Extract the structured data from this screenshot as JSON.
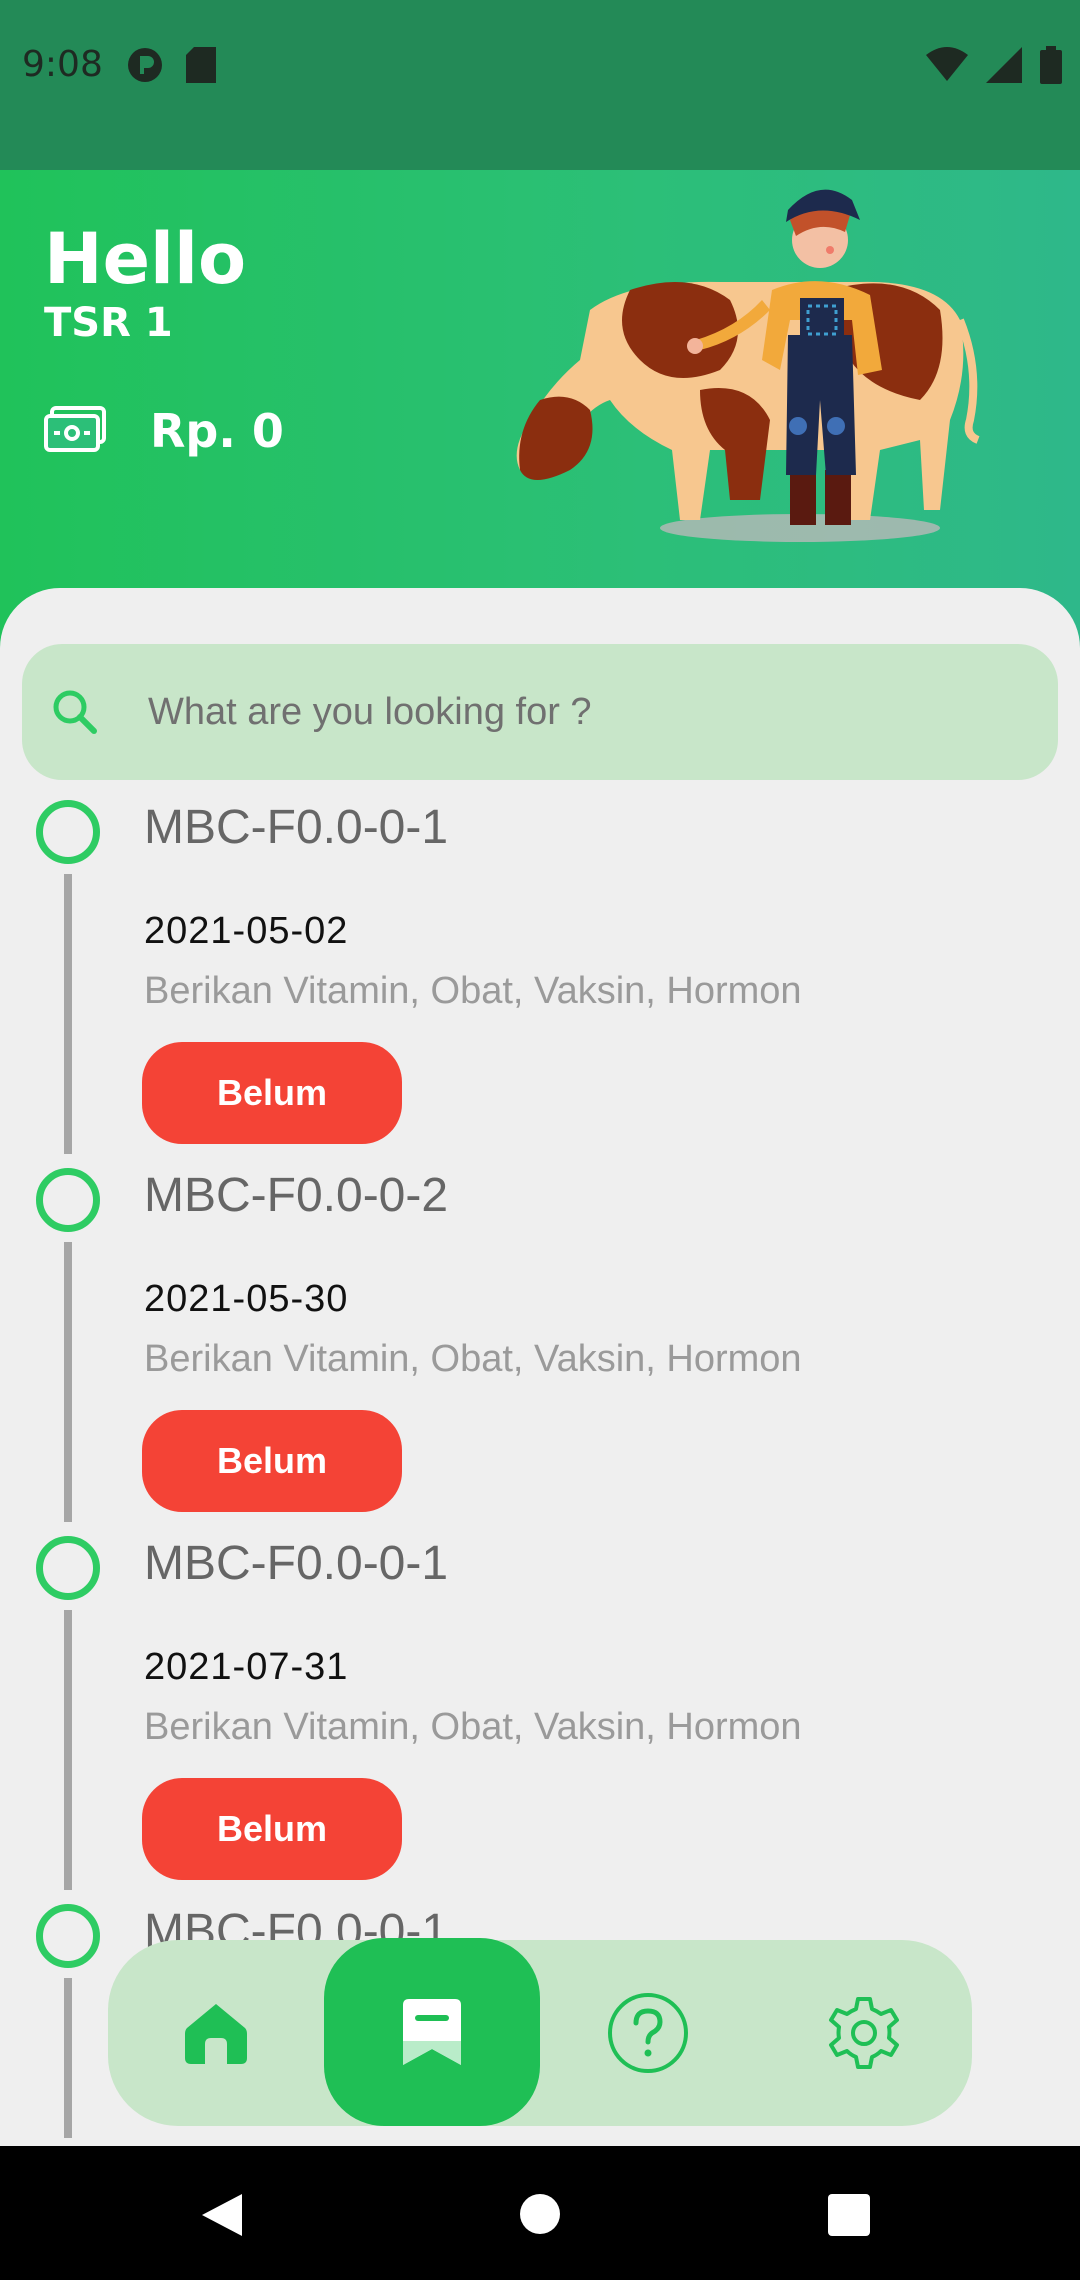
{
  "status_bar": {
    "time": "9:08"
  },
  "header": {
    "greeting": "Hello",
    "username": "TSR 1",
    "balance": "Rp. 0"
  },
  "search": {
    "placeholder": "What are you looking for ?"
  },
  "timeline": [
    {
      "title": "MBC-F0.0-0-1",
      "date": "2021-05-02",
      "description": "Berikan Vitamin, Obat, Vaksin, Hormon",
      "status": "Belum"
    },
    {
      "title": "MBC-F0.0-0-2",
      "date": "2021-05-30",
      "description": "Berikan Vitamin, Obat, Vaksin, Hormon",
      "status": "Belum"
    },
    {
      "title": "MBC-F0.0-0-1",
      "date": "2021-07-31",
      "description": "Berikan Vitamin, Obat, Vaksin, Hormon",
      "status": "Belum"
    },
    {
      "title": "MBC-F0.0-0-1"
    }
  ],
  "bottom_nav": {
    "items": [
      {
        "icon": "home-icon"
      },
      {
        "icon": "schedule-icon",
        "active": true
      },
      {
        "icon": "help-icon"
      },
      {
        "icon": "settings-icon"
      }
    ]
  },
  "colors": {
    "primary": "#1fbf55",
    "danger": "#f44336",
    "nav_bg": "#c8e6c9"
  }
}
